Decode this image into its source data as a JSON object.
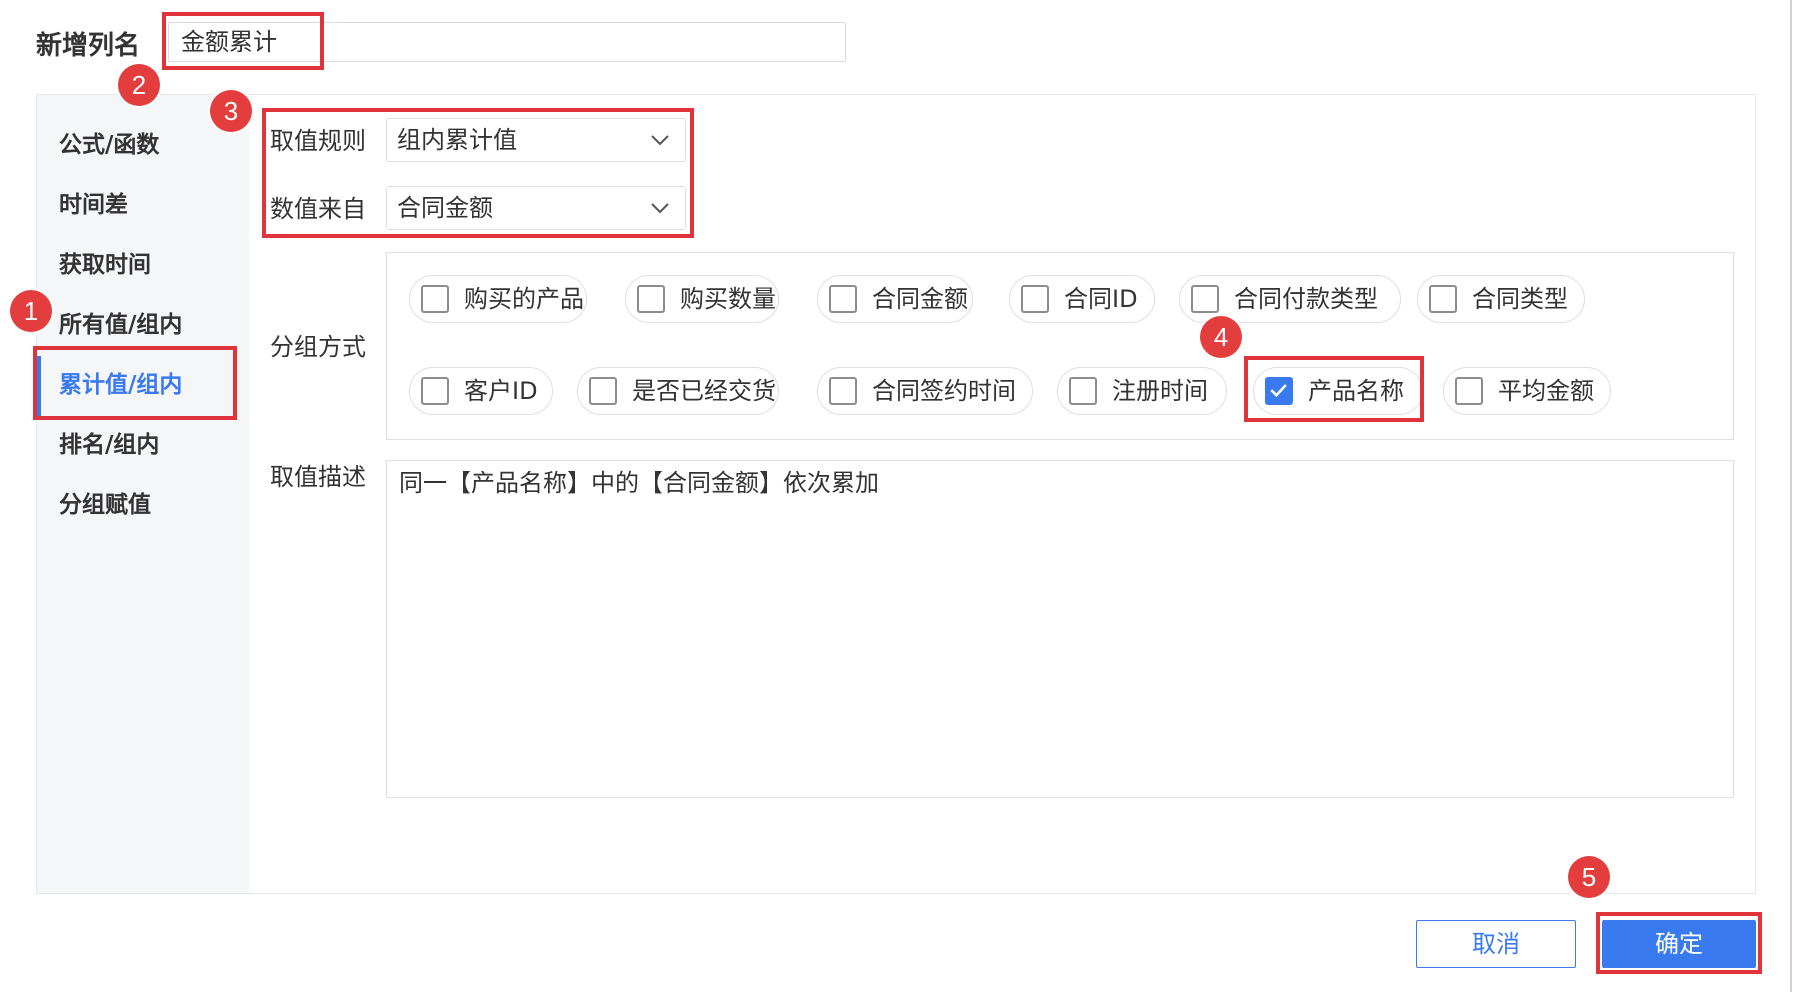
{
  "header": {
    "label": "新增列名",
    "name_value": "金额累计"
  },
  "sidebar": {
    "items": [
      {
        "label": "公式/函数",
        "active": false
      },
      {
        "label": "时间差",
        "active": false
      },
      {
        "label": "获取时间",
        "active": false
      },
      {
        "label": "所有值/组内",
        "active": false
      },
      {
        "label": "累计值/组内",
        "active": true
      },
      {
        "label": "排名/组内",
        "active": false
      },
      {
        "label": "分组赋值",
        "active": false
      }
    ]
  },
  "form": {
    "rule_label": "取值规则",
    "rule_value": "组内累计值",
    "source_label": "数值来自",
    "source_value": "合同金额",
    "group_label": "分组方式",
    "desc_label": "取值描述",
    "description": "同一【产品名称】中的【合同金额】依次累加"
  },
  "group_options": [
    {
      "label": "购买的产品",
      "checked": false
    },
    {
      "label": "购买数量",
      "checked": false
    },
    {
      "label": "合同金额",
      "checked": false
    },
    {
      "label": "合同ID",
      "checked": false
    },
    {
      "label": "合同付款类型",
      "checked": false
    },
    {
      "label": "合同类型",
      "checked": false
    },
    {
      "label": "客户ID",
      "checked": false
    },
    {
      "label": "是否已经交货",
      "checked": false
    },
    {
      "label": "合同签约时间",
      "checked": false
    },
    {
      "label": "注册时间",
      "checked": false
    },
    {
      "label": "产品名称",
      "checked": true
    },
    {
      "label": "平均金额",
      "checked": false
    }
  ],
  "buttons": {
    "cancel": "取消",
    "ok": "确定"
  },
  "badges": [
    "1",
    "2",
    "3",
    "4",
    "5"
  ],
  "colors": {
    "accent": "#3a7af0",
    "annotation": "#e0343c"
  },
  "icons": {
    "dropdown": "chevron-down-icon",
    "check": "check-icon"
  }
}
